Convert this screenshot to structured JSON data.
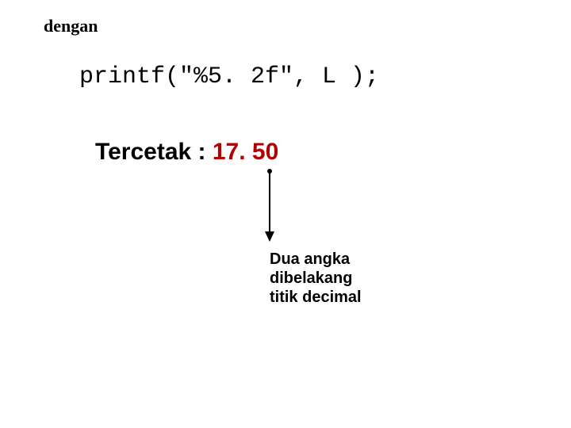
{
  "header": "dengan",
  "code": "printf(\"%5. 2f\", L );",
  "output_label": "Tercetak : ",
  "output_value": "17. 50",
  "annotation": "Dua angka\ndibelakang\ntitik decimal"
}
